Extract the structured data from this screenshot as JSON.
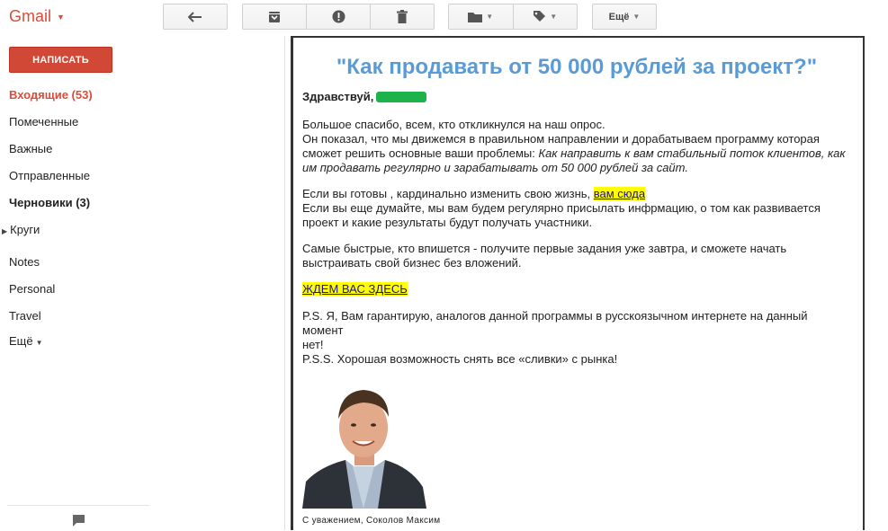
{
  "topbar": {
    "brand": "Gmail",
    "more_label": "Ещё"
  },
  "sidebar": {
    "compose_label": "НАПИСАТЬ",
    "items": [
      {
        "label": "Входящие (53)"
      },
      {
        "label": "Помеченные"
      },
      {
        "label": "Важные"
      },
      {
        "label": "Отправленные"
      },
      {
        "label": "Черновики (3)"
      },
      {
        "label": "Круги"
      },
      {
        "label": "Notes"
      },
      {
        "label": "Personal"
      },
      {
        "label": "Travel"
      },
      {
        "label": "Ещё"
      }
    ]
  },
  "message": {
    "headline": "\"Как продавать от 50 000 рублей за проект?\"",
    "greeting": "Здравствуй,",
    "p1_line1": "Большое спасибо, всем,  кто откликнулся на наш опрос.",
    "p1_line2": "Он показал, что мы движемся в правильном направлении и дорабатываем программу которая",
    "p1_line3a": "сможет решить основные ваши проблемы: ",
    "p1_line3b": "Как направить к вам стабильный поток клиентов, как",
    "p1_line4": "им продавать регулярно и зарабатывать от 50 000 рублей за сайт.",
    "p2_line1a": "Если вы готовы , кардинально  изменить свою жизнь, ",
    "p2_link": "вам сюда",
    "p2_line2": "Если вы еще думайте, мы вам будем регулярно присылать инфрмацию, о том как развивается",
    "p2_line3": "проект и какие результаты будут получать участники.",
    "p3_line1": "Самые быстрые, кто впишется - получите первые задания уже завтра, и сможете начать",
    "p3_line2": "выстраивать свой бизнес без вложений.",
    "cta_link": "ЖДЕМ ВАС ЗДЕСЬ",
    "ps_line1": "P.S. Я, Вам гарантирую, аналогов данной программы в русскоязычном интернете на данный момент",
    "ps_line2": "нет!",
    "pss_line": "P.S.S. Хорошая возможность снять все «сливки» с рынка!",
    "signature": "С уважением, Соколов Максим"
  },
  "colors": {
    "accent": "#dd4b39",
    "compose": "#d14836",
    "headline": "#5b9bd5",
    "highlight": "#ffff00",
    "censor": "#1db34a"
  }
}
